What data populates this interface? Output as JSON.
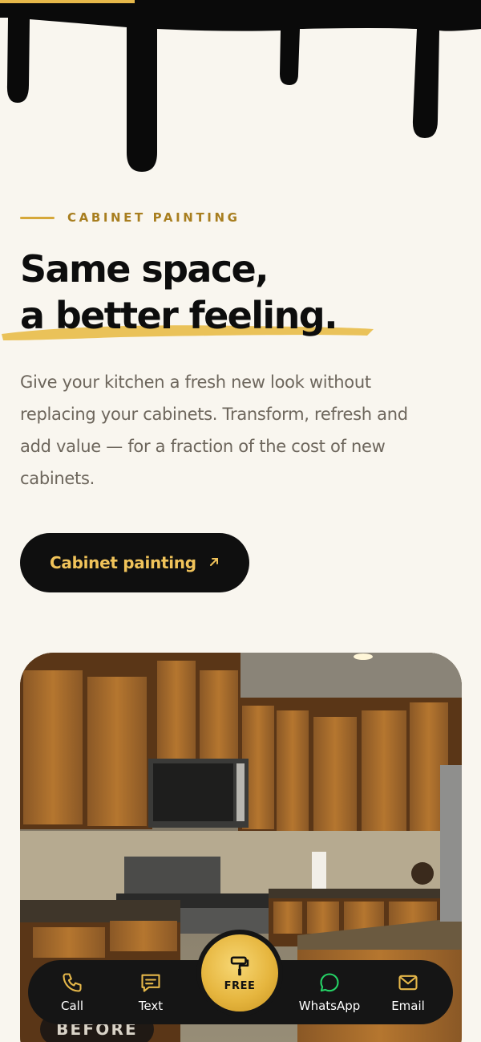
{
  "header": {
    "progress_fraction": 0.28
  },
  "hero": {
    "eyebrow": "CABINET PAINTING",
    "headline_line1": "Same space,",
    "headline_line2": "a better feeling.",
    "lede": "Give your kitchen a fresh new look without replacing your cabinets. Transform, refresh and add value — for a fraction of the cost of new cabinets.",
    "cta_label": "Cabinet painting",
    "cta_icon": "arrow-up-right-icon"
  },
  "photo": {
    "badge": "BEFORE"
  },
  "bottom_nav": {
    "items": [
      {
        "label": "Call",
        "icon": "phone-icon"
      },
      {
        "label": "Text",
        "icon": "message-icon"
      },
      {
        "label": "WhatsApp",
        "icon": "whatsapp-icon"
      },
      {
        "label": "Email",
        "icon": "mail-icon"
      }
    ],
    "center_label": "FREE",
    "center_icon": "paint-roller-icon"
  },
  "colors": {
    "accent": "#e6b84a",
    "dark": "#0f0f0f",
    "background": "#f9f6ef",
    "whatsapp": "#25d366"
  }
}
